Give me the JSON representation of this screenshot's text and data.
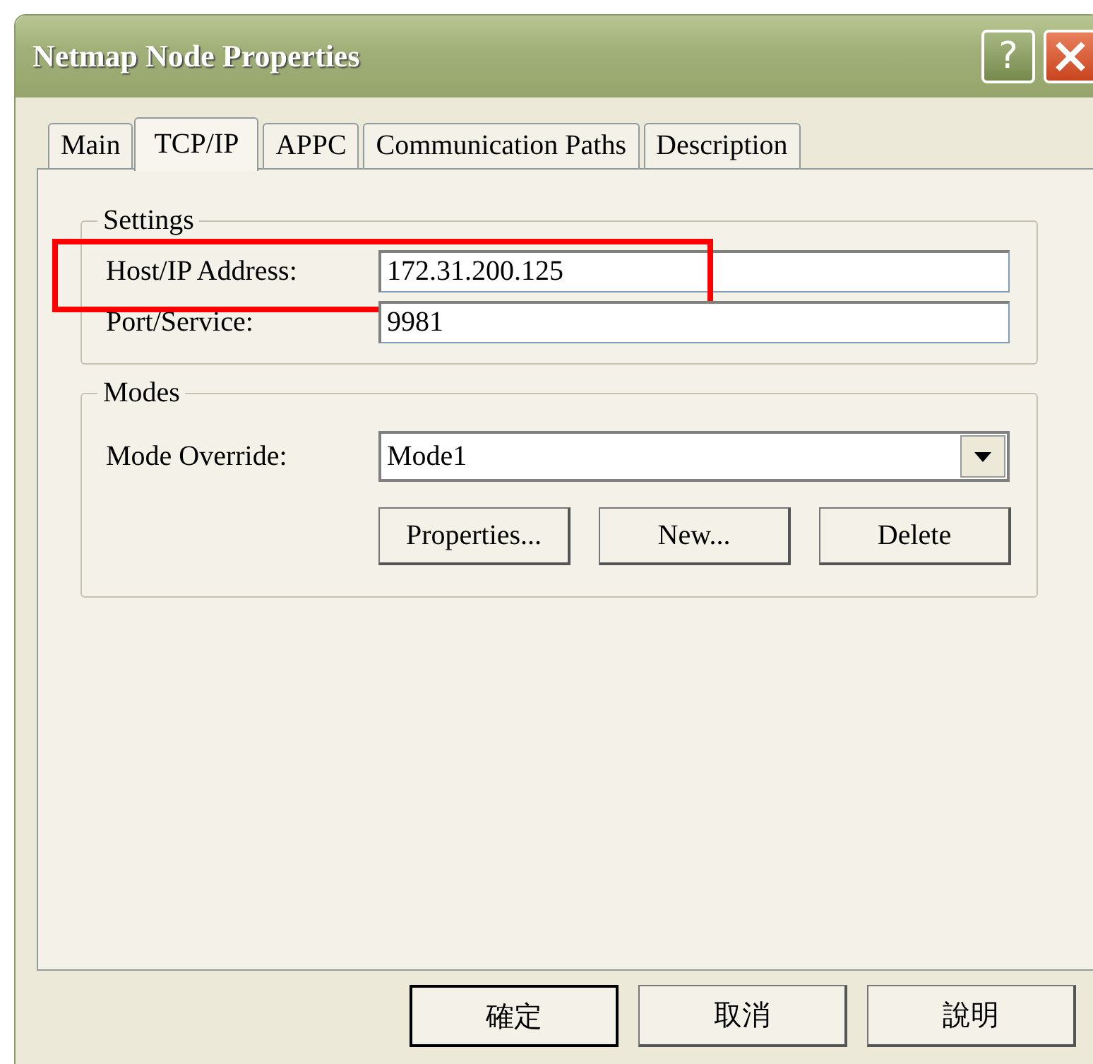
{
  "window": {
    "title": "Netmap Node Properties",
    "help_button": "?"
  },
  "tabs": [
    {
      "label": "Main",
      "selected": false
    },
    {
      "label": "TCP/IP",
      "selected": true
    },
    {
      "label": "APPC",
      "selected": false
    },
    {
      "label": "Communication Paths",
      "selected": false
    },
    {
      "label": "Description",
      "selected": false
    }
  ],
  "settings": {
    "title": "Settings",
    "fields": [
      {
        "label": "Host/IP Address:",
        "value": "172.31.200.125",
        "highlighted": true
      },
      {
        "label": "Port/Service:",
        "value": "9981",
        "highlighted": false
      }
    ]
  },
  "modes": {
    "title": "Modes",
    "mode_override": {
      "label": "Mode Override:",
      "value": "Mode1"
    },
    "buttons": [
      "Properties...",
      "New...",
      "Delete"
    ]
  },
  "buttons": [
    {
      "label": "確定",
      "default": true
    },
    {
      "label": "取消",
      "default": false
    },
    {
      "label": "說明",
      "default": false
    }
  ]
}
